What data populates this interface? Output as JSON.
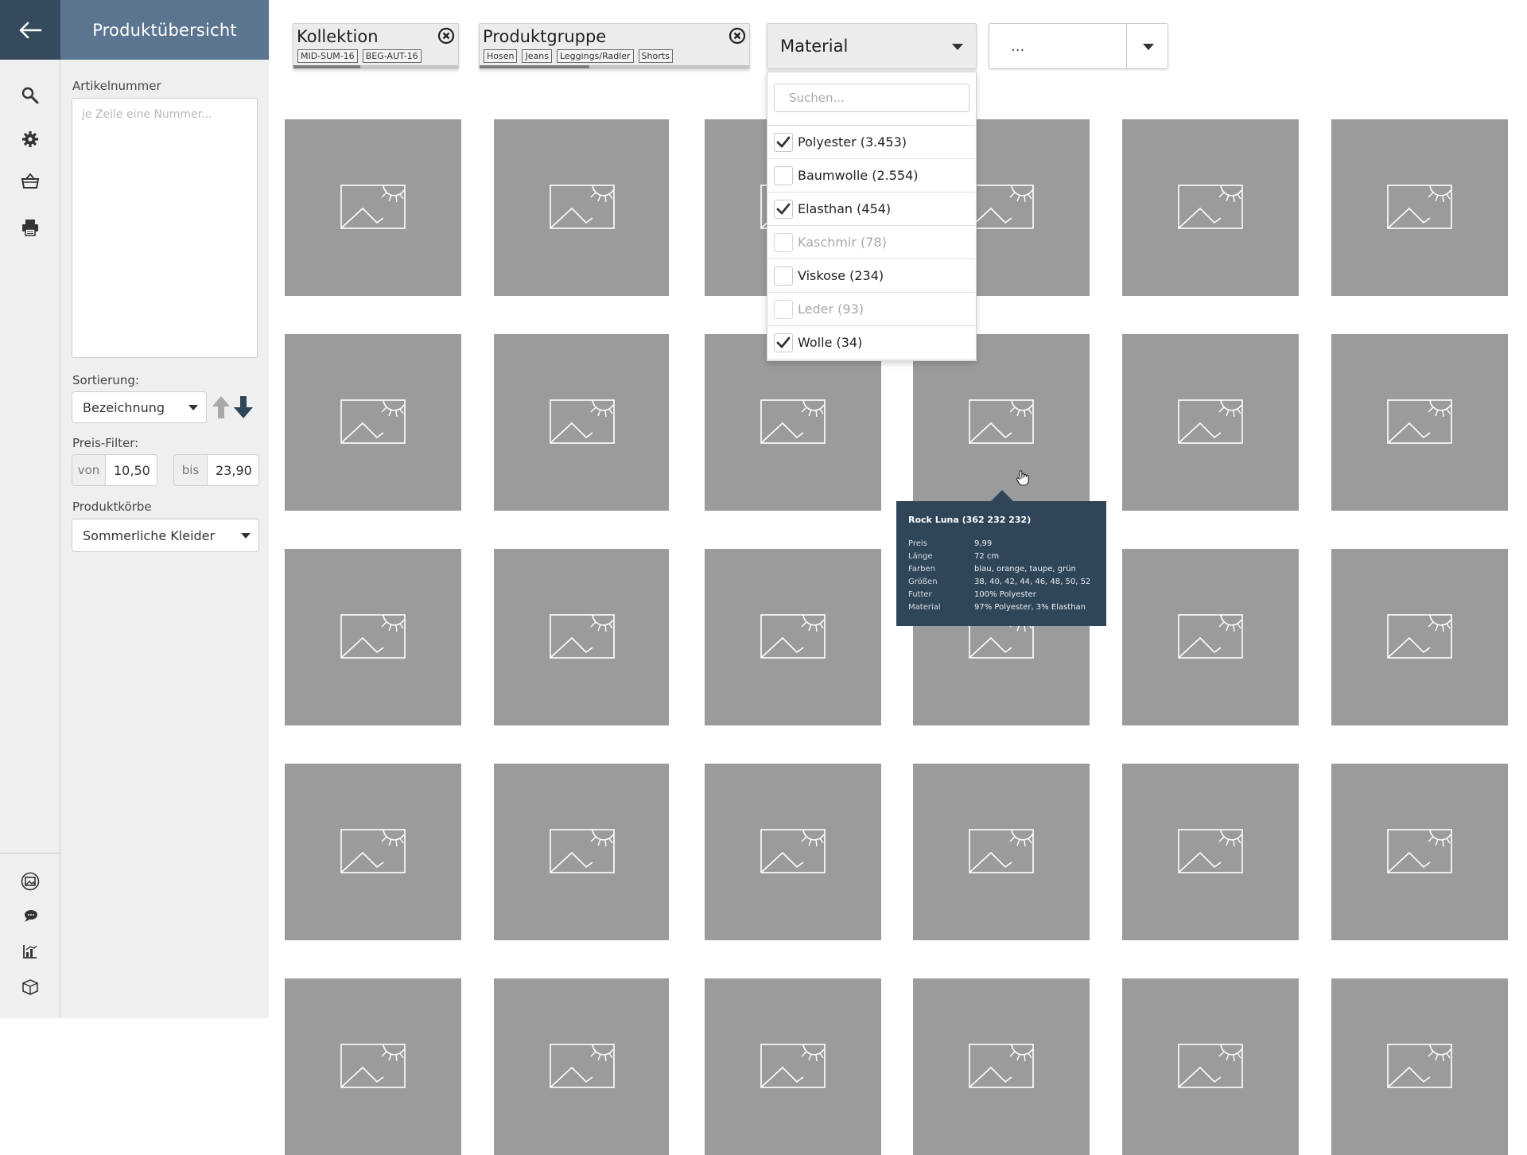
{
  "panel": {
    "title": "Produktübersicht",
    "article_label": "Artikelnummer",
    "article_placeholder": "je Zeile eine Nummer...",
    "sort_label": "Sortierung:",
    "sort_value": "Bezeichnung",
    "price_label": "Preis-Filter:",
    "price_from_label": "von",
    "price_from_value": "10,50",
    "price_to_label": "bis",
    "price_to_value": "23,90",
    "baskets_label": "Produktkörbe",
    "baskets_value": "Sommerliche Kleider"
  },
  "rail": {
    "top_icons": [
      "search-icon",
      "gear-icon",
      "basket-icon",
      "printer-icon"
    ],
    "bottom_icons": [
      "gallery-icon",
      "comment-icon",
      "chart-icon",
      "package-icon"
    ]
  },
  "filters": {
    "kollektion": {
      "title": "Kollektion",
      "tags": [
        "MID-SUM-16",
        "BEG-AUT-16"
      ]
    },
    "produktgruppe": {
      "title": "Produktgruppe",
      "tags": [
        "Hosen",
        "Jeans",
        "Leggings/Radler",
        "Shorts"
      ]
    },
    "material": {
      "title": "Material"
    },
    "extra": {
      "title": "..."
    }
  },
  "material_menu": {
    "search_placeholder": "Suchen...",
    "options": [
      {
        "label": "Polyester (3.453)",
        "checked": true,
        "disabled": false
      },
      {
        "label": "Baumwolle (2.554)",
        "checked": false,
        "disabled": false
      },
      {
        "label": "Elasthan (454)",
        "checked": true,
        "disabled": false
      },
      {
        "label": "Kaschmir (78)",
        "checked": false,
        "disabled": true
      },
      {
        "label": "Viskose (234)",
        "checked": false,
        "disabled": false
      },
      {
        "label": "Leder (93)",
        "checked": false,
        "disabled": true
      },
      {
        "label": "Wolle (34)",
        "checked": true,
        "disabled": false
      }
    ]
  },
  "tooltip": {
    "title": "Rock Luna (362 232 232)",
    "rows": [
      {
        "key": "Preis",
        "value": "9,99"
      },
      {
        "key": "Länge",
        "value": "72 cm"
      },
      {
        "key": "Farben",
        "value": "blau, orange, taupe, grün"
      },
      {
        "key": "Größen",
        "value": "38, 40, 42, 44, 46, 48, 50, 52"
      },
      {
        "key": "Futter",
        "value": "100% Polyester"
      },
      {
        "key": "Material",
        "value": "97% Polyester, 3% Elasthan"
      }
    ]
  },
  "colors": {
    "header_dark": "#354a5c",
    "header_panel": "#5b7590",
    "tile": "#9b9b9b",
    "tooltip": "#2f4659"
  }
}
